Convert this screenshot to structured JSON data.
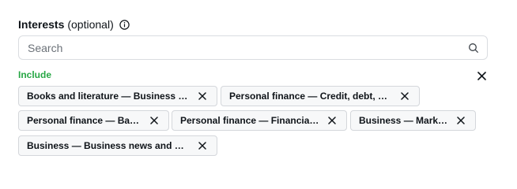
{
  "field": {
    "label": "Interests",
    "optional_text": "(optional)",
    "info_icon": "info-circle-icon"
  },
  "search": {
    "placeholder": "Search",
    "value": "",
    "icon": "search-icon"
  },
  "include": {
    "label": "Include",
    "clear_icon": "close-icon",
    "accent_color": "#27a745"
  },
  "chips": [
    {
      "label": "Books and literature — Business and finance",
      "remove_icon": "close-icon"
    },
    {
      "label": "Personal finance — Credit, debt, and loans",
      "remove_icon": "close-icon"
    },
    {
      "label": "Personal finance — Banking",
      "remove_icon": "close-icon"
    },
    {
      "label": "Personal finance — Financial news",
      "remove_icon": "close-icon"
    },
    {
      "label": "Business — Marketing",
      "remove_icon": "close-icon"
    },
    {
      "label": "Business — Business news and general info",
      "remove_icon": "close-icon"
    }
  ]
}
